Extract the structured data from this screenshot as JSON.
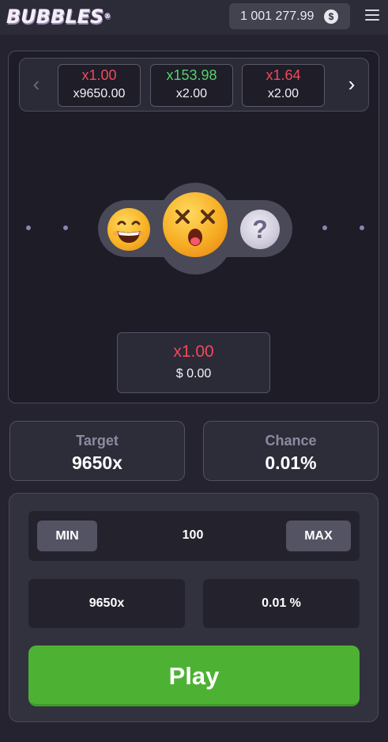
{
  "header": {
    "logo_text": "BUBBLES",
    "logo_mark": "®",
    "balance": "1 001 277.99",
    "currency_icon": "dollar-coin-icon",
    "currency_symbol": "$",
    "menu_icon": "hamburger-menu-icon"
  },
  "history": {
    "prev_arrow": "‹",
    "next_arrow": "›",
    "items": [
      {
        "multiplier": "x1.00",
        "target": "x9650.00",
        "status": "lose",
        "color": "#ef4a5c"
      },
      {
        "multiplier": "x153.98",
        "target": "x2.00",
        "status": "win",
        "color": "#55d26a"
      },
      {
        "multiplier": "x1.64",
        "target": "x2.00",
        "status": "lose",
        "color": "#ef4a5c"
      }
    ]
  },
  "bubbles": {
    "left": "smiling-face-icon",
    "center": "dizzy-face-icon",
    "right": "question-bubble-icon",
    "right_symbol": "?"
  },
  "result": {
    "multiplier": "x1.00",
    "amount": "$ 0.00"
  },
  "stats": {
    "target_label": "Target",
    "target_value": "9650x",
    "chance_label": "Chance",
    "chance_value": "0.01%"
  },
  "controls": {
    "min_label": "MIN",
    "stake": "100",
    "max_label": "MAX",
    "target_input": "9650x",
    "chance_input": "0.01 %",
    "play_label": "Play"
  },
  "colors": {
    "background": "#24232f",
    "loss": "#ef4a5c",
    "win": "#55d26a",
    "play": "#4db233"
  }
}
